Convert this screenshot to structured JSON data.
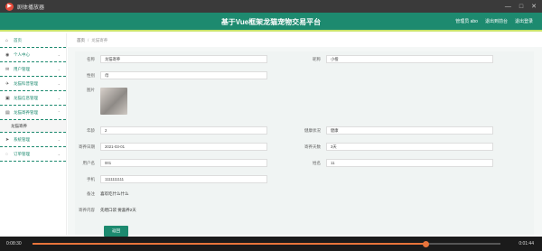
{
  "window": {
    "title": "剧体播放器",
    "controls": [
      "—",
      "□",
      "✕"
    ]
  },
  "header": {
    "title": "基于Vue框架龙猫宠物交易平台",
    "links": [
      "管理员 abo",
      "退出到前台",
      "退出登录"
    ]
  },
  "sidebar": {
    "items": [
      {
        "label": "首页",
        "icon": "home-icon"
      },
      {
        "label": "个人中心",
        "icon": "user-icon"
      },
      {
        "label": "用户管理",
        "icon": "users-icon"
      },
      {
        "label": "龙猫科普管理",
        "icon": "book-icon"
      },
      {
        "label": "龙猫信息管理",
        "icon": "info-icon"
      },
      {
        "label": "龙猫寄养管理",
        "icon": "box-icon"
      },
      {
        "label": "系统管理",
        "icon": "settings-icon"
      },
      {
        "label": "订单管理",
        "icon": "order-icon"
      }
    ],
    "sub_item": "龙猫寄养"
  },
  "breadcrumb": {
    "home": "首页",
    "current": "龙猫寄养"
  },
  "form": {
    "name_label": "名称",
    "name_value": "龙猫寄养",
    "nick_label": "昵称",
    "nick_value": "小橙",
    "gender_label": "性别",
    "gender_value": "母",
    "image_label": "图片",
    "age_label": "年龄",
    "age_value": "2",
    "health_label": "健康状况",
    "health_value": "健康",
    "date_label": "寄养日期",
    "date_value": "2021-03-01",
    "days_label": "寄养天数",
    "days_value": "3天",
    "account_label": "用户名",
    "account_value": "001",
    "status_label": "姓名",
    "status_value": "11",
    "phone_label": "手机",
    "phone_value": "1111111111",
    "remark_label": "备注",
    "remark_value": "喜欢吃什么什么",
    "content_label": "寄养内容",
    "content_value": "先喂口袋 要喜养2天",
    "back_button": "返回"
  },
  "player": {
    "current": "0:08:30",
    "duration": "0:01:44",
    "progress": 0.84
  },
  "colors": {
    "accent": "#1d8a6f",
    "highlight": "#c8e36a",
    "progress": "#e8743b"
  }
}
